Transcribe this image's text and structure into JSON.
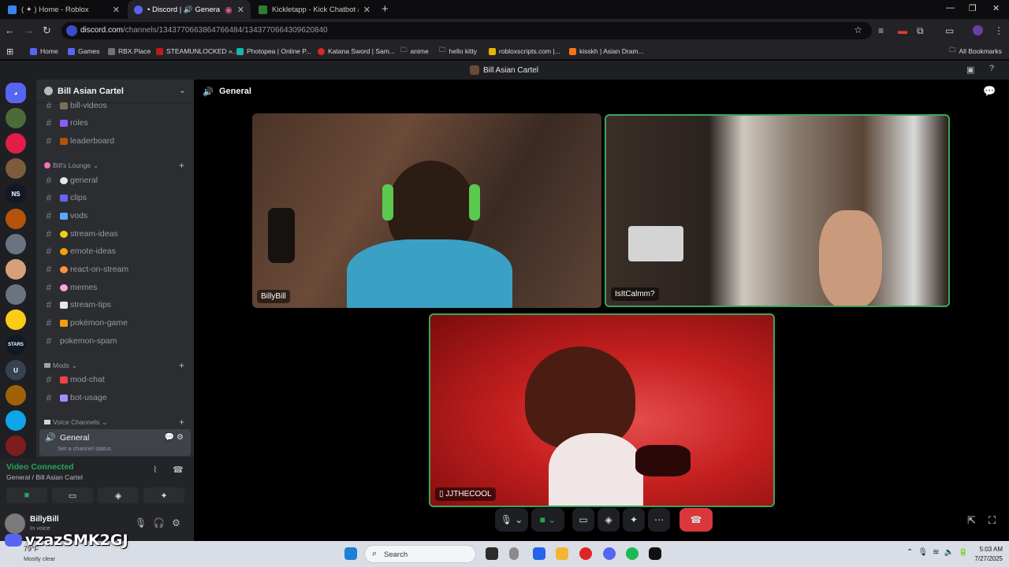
{
  "browser": {
    "tabs": [
      {
        "title": "( ✦ ) Home - Roblox",
        "active": false,
        "color": "#3b82f6"
      },
      {
        "title": "• Discord | 🔊 General | Bill",
        "active": true,
        "color": "#5865f2"
      },
      {
        "title": "Kickletapp - Kick Chatbot and",
        "active": false,
        "color": "#2e7d32"
      }
    ],
    "url_domain": "discord.com",
    "url_path": "/channels/1343770663864766484/1343770664309620840",
    "bookmarks": [
      {
        "label": "Home",
        "color": "#5865f2"
      },
      {
        "label": "Games",
        "color": "#5865f2"
      },
      {
        "label": "RBX.Place",
        "color": "#6b7280"
      },
      {
        "label": "STEAMUNLOCKED »...",
        "color": "#b91c1c"
      },
      {
        "label": "Photopea | Online P...",
        "color": "#14b8a6"
      },
      {
        "label": "Katana Sword | Sam...",
        "color": "#dc2626"
      },
      {
        "label": "anime",
        "color": "#9ca3af"
      },
      {
        "label": "hello kitty",
        "color": "#9ca3af"
      },
      {
        "label": "robloxscripts.com |...",
        "color": "#eab308"
      },
      {
        "label": "kisskh | Asian Dram...",
        "color": "#f97316"
      }
    ],
    "all_bookmarks": "All Bookmarks"
  },
  "discord": {
    "window_title": "Bill Asian Cartel",
    "server_name": "Bill Asian Cartel",
    "channels_top": [
      {
        "name": "bill-videos"
      },
      {
        "name": "roles"
      },
      {
        "name": "leaderboard"
      }
    ],
    "category_lounge": "Bill's Lounge",
    "channels_lounge": [
      {
        "name": "general"
      },
      {
        "name": "clips"
      },
      {
        "name": "vods"
      },
      {
        "name": "stream-ideas"
      },
      {
        "name": "emote-ideas"
      },
      {
        "name": "react-on-stream"
      },
      {
        "name": "memes"
      },
      {
        "name": "stream-tips"
      },
      {
        "name": "pokémon-game"
      },
      {
        "name": "pokemon-spam"
      }
    ],
    "category_mods": "Mods",
    "channels_mods": [
      {
        "name": "mod-chat"
      },
      {
        "name": "bot-usage"
      }
    ],
    "category_voice": "Voice Channels",
    "voice_channel": "General",
    "voice_status": "Set a channel status",
    "rtc_title": "Video Connected",
    "rtc_where": "General / Bill Asian Cartel",
    "user_name": "BillyBill",
    "user_status": "In voice",
    "call_title": "General",
    "participants": [
      {
        "name": "BillyBill"
      },
      {
        "name": "IsItCalmm?"
      },
      {
        "name": "JJTHECOOL"
      }
    ],
    "servers": [
      {
        "label": "",
        "color": "#5865f2"
      },
      {
        "label": "",
        "color": "#4b6b3a"
      },
      {
        "label": "",
        "color": "#e11d48"
      },
      {
        "label": "",
        "color": "#7c5c3a"
      },
      {
        "label": "NS",
        "color": "#111827"
      },
      {
        "label": "",
        "color": "#b45309"
      },
      {
        "label": "",
        "color": "#6b7280"
      },
      {
        "label": "",
        "color": "#d6a17a"
      },
      {
        "label": "",
        "color": "#6b7280"
      },
      {
        "label": "",
        "color": "#facc15"
      },
      {
        "label": "STARS",
        "color": "#111827"
      },
      {
        "label": "U",
        "color": "#374151"
      },
      {
        "label": "",
        "color": "#a16207"
      },
      {
        "label": "",
        "color": "#0ea5e9"
      },
      {
        "label": "",
        "color": "#7f1d1d"
      }
    ]
  },
  "taskbar": {
    "temperature": "79°F",
    "weather": "Mostly clear",
    "search_placeholder": "Search",
    "time": "5:03 AM",
    "date": "7/27/2025"
  },
  "watermark": "vzazSMK2GJ"
}
